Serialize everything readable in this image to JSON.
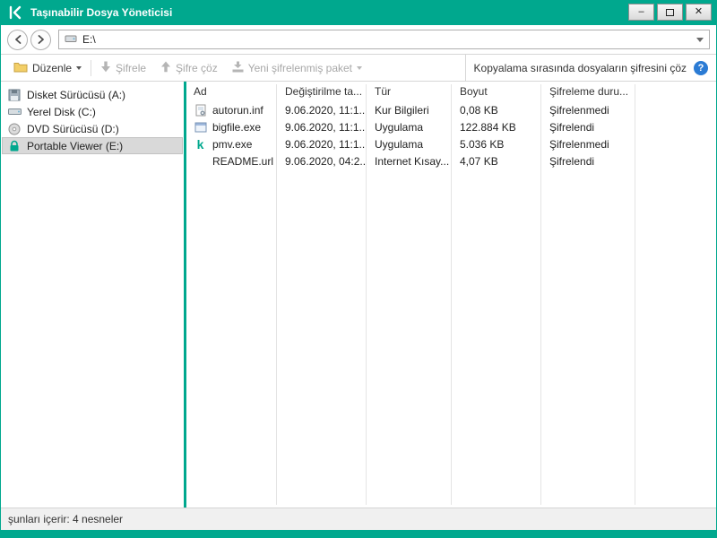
{
  "window": {
    "title": "Taşınabilir Dosya Yöneticisi",
    "brand_color": "#00A88E",
    "controls": {
      "minimize": "–",
      "close": "✕"
    }
  },
  "navbar": {
    "address": "E:\\"
  },
  "toolbar": {
    "organize_label": "Düzenle",
    "encrypt_label": "Şifrele",
    "decrypt_label": "Şifre çöz",
    "new_package_label": "Yeni şifrelenmiş paket",
    "decrypt_on_copy_label": "Kopyalama sırasında dosyaların şifresini çöz",
    "help_glyph": "?"
  },
  "sidebar": {
    "items": [
      {
        "label": "Disket Sürücüsü (A:)",
        "icon": "floppy-drive-icon",
        "selected": false
      },
      {
        "label": "Yerel Disk (C:)",
        "icon": "hard-disk-icon",
        "selected": false
      },
      {
        "label": "DVD Sürücüsü (D:)",
        "icon": "dvd-drive-icon",
        "selected": false
      },
      {
        "label": "Portable Viewer (E:)",
        "icon": "encrypted-drive-lock-icon",
        "selected": true
      }
    ]
  },
  "file_list": {
    "columns": [
      "Ad",
      "Değiştirilme ta...",
      "Tür",
      "Boyut",
      "Şifreleme duru..."
    ],
    "rows": [
      {
        "icon": "setup-information-file-icon",
        "name": "autorun.inf",
        "modified": "9.06.2020, 11:1...",
        "type": "Kur Bilgileri",
        "size": "0,08 KB",
        "encryption": "Şifrelenmedi"
      },
      {
        "icon": "application-file-icon",
        "name": "bigfile.exe",
        "modified": "9.06.2020, 11:1...",
        "type": "Uygulama",
        "size": "122.884 KB",
        "encryption": "Şifrelendi"
      },
      {
        "icon": "kaspersky-app-file-icon",
        "icon_glyph": "k",
        "name": "pmv.exe",
        "modified": "9.06.2020, 11:1...",
        "type": "Uygulama",
        "size": "5.036 KB",
        "encryption": "Şifrelenmedi"
      },
      {
        "icon": "url-file-icon",
        "name": "README.url",
        "modified": "9.06.2020, 04:2...",
        "type": "Internet Kısay...",
        "size": "4,07 KB",
        "encryption": "Şifrelendi"
      }
    ]
  },
  "statusbar": {
    "text": "şunları içerir: 4 nesneler"
  }
}
